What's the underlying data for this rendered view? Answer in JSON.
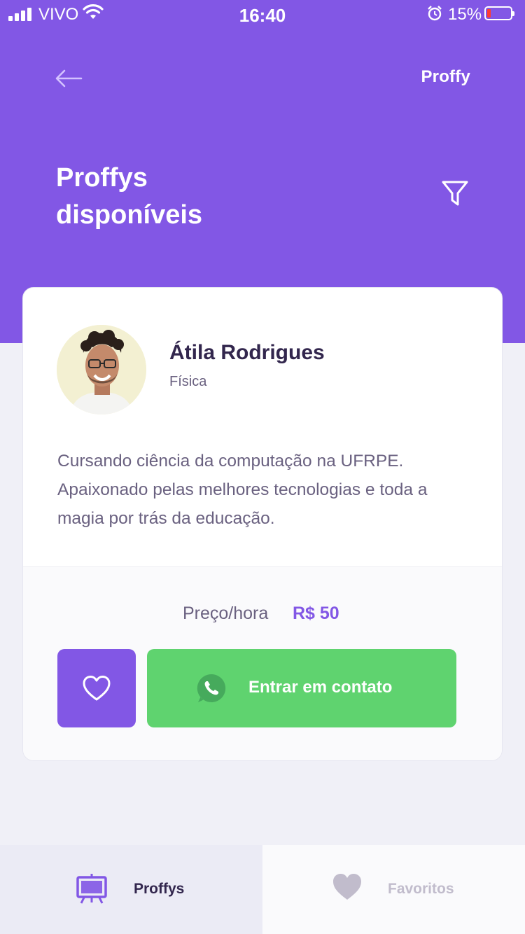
{
  "status_bar": {
    "carrier": "VIVO",
    "time": "16:40",
    "battery_percent": "15%",
    "battery_level": 0.15,
    "battery_color": "#FF3B30"
  },
  "header": {
    "back_icon": "arrow-left-icon",
    "logo_text": "Proffy",
    "title_line1": "Proffys",
    "title_line2": "disponíveis",
    "filter_icon": "filter-icon",
    "background_color": "#8257E5"
  },
  "teacher_card": {
    "name": "Átila Rodrigues",
    "subject": "Física",
    "bio": "Cursando ciência da computação na UFRPE. Apaixonado pelas melhores tecnologias e toda a magia por trás da educação.",
    "price_label": "Preço/hora",
    "price_value": "R$ 50",
    "favorite_icon": "heart-outline-icon",
    "contact_icon": "whatsapp-icon",
    "contact_label": "Entrar em contato",
    "contact_color": "#5FD36F",
    "favorite_color": "#8257E5"
  },
  "tab_bar": {
    "tabs": [
      {
        "label": "Proffys",
        "icon": "easel-icon",
        "active": true
      },
      {
        "label": "Favoritos",
        "icon": "heart-icon",
        "active": false
      }
    ],
    "active_color": "#8257E5",
    "inactive_color": "#C1BCCC"
  }
}
